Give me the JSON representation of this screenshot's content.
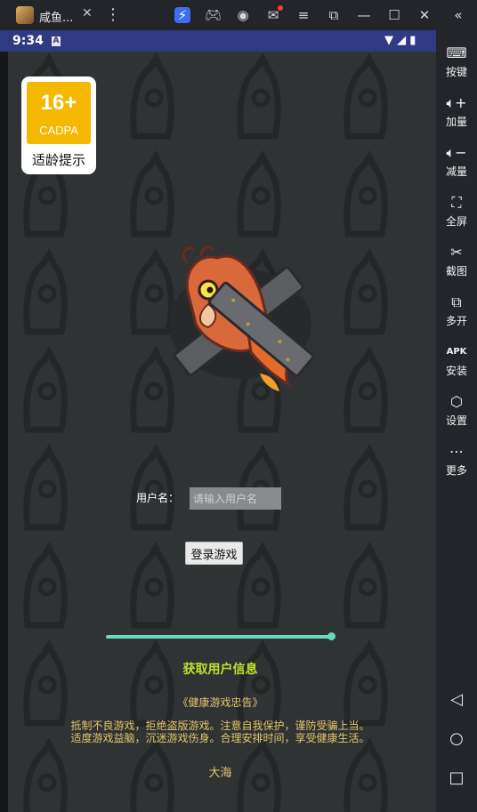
{
  "window": {
    "title": "咸鱼..."
  },
  "toolbar": {
    "menu_glyph": "⋮"
  },
  "status": {
    "time": "9:34",
    "notify_badge": "A"
  },
  "sidebar": {
    "items": [
      {
        "label": "按键",
        "icon": "keyboard-icon"
      },
      {
        "label": "加量",
        "icon": "volume-up-icon"
      },
      {
        "label": "减量",
        "icon": "volume-down-icon"
      },
      {
        "label": "全屏",
        "icon": "fullscreen-icon"
      },
      {
        "label": "截图",
        "icon": "scissors-icon"
      },
      {
        "label": "多开",
        "icon": "multi-instance-icon"
      },
      {
        "label": "安装",
        "icon": "apk-install-icon"
      },
      {
        "label": "设置",
        "icon": "settings-icon"
      },
      {
        "label": "更多",
        "icon": "more-icon"
      }
    ]
  },
  "age_rating": {
    "age": "16+",
    "org": "CADPA",
    "caption": "适龄提示"
  },
  "login": {
    "username_label": "用户名：",
    "username_placeholder": "请输入用户名",
    "button_label": "登录游戏"
  },
  "progress": {
    "fraction": 1.0,
    "color": "#67d9bd"
  },
  "fetch_user_info": "获取用户信息",
  "health_advice": {
    "title": "《健康游戏忠告》",
    "line1": "抵制不良游戏，拒绝盗版游戏。注意自我保护，谨防受骗上当。",
    "line2": "适度游戏益脑，沉迷游戏伤身。合理安排时间，享受健康生活。"
  },
  "footer": "大海",
  "colors": {
    "status_bar": "#2e3b84",
    "accent_text": "#c3e02a",
    "advice_text": "#e4c66a",
    "rating_badge": "#f5b800"
  }
}
